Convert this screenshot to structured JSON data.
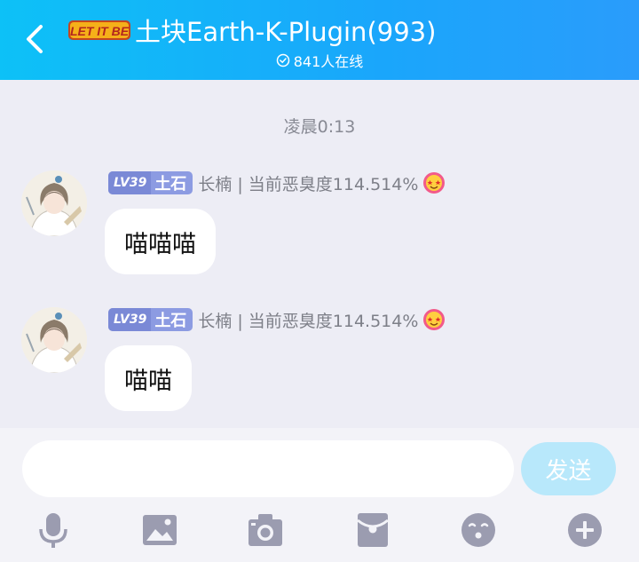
{
  "header": {
    "logo_text": "LET IT BE",
    "title": "土块Earth-K-Plugin(993)",
    "online": "841人在线"
  },
  "chat": {
    "timestamp": "凌晨0:13",
    "messages": [
      {
        "level": "LV39",
        "rank": "土石",
        "sender": "长楠 | 当前恶臭度114.514%",
        "text": "喵喵喵"
      },
      {
        "level": "LV39",
        "rank": "土石",
        "sender": "长楠 | 当前恶臭度114.514%",
        "text": "喵喵"
      }
    ]
  },
  "input": {
    "value": "",
    "placeholder": "",
    "send_label": "发送"
  },
  "toolbar": {
    "icons": [
      "microphone-icon",
      "image-icon",
      "camera-icon",
      "red-packet-icon",
      "emoji-icon",
      "plus-icon"
    ]
  },
  "colors": {
    "header_start": "#0dc1f7",
    "header_end": "#2a9cfb",
    "background": "#ededf5",
    "badge": "#8c9be2",
    "send_button": "#b8e8fb",
    "toolbar_icon": "#9b9cb0"
  }
}
